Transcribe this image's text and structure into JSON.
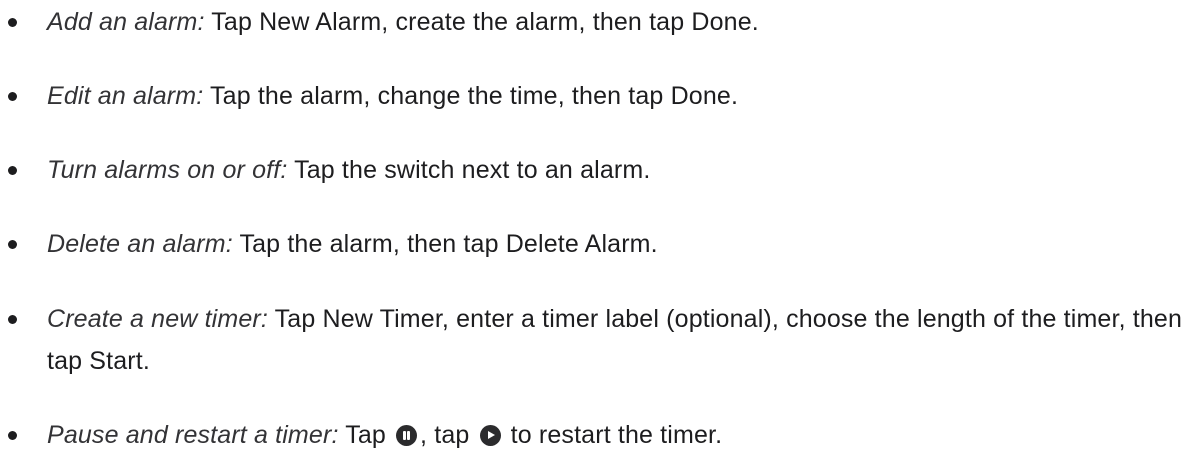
{
  "items": [
    {
      "term": "Add an alarm:",
      "text": " Tap New Alarm, create the alarm, then tap Done."
    },
    {
      "term": "Edit an alarm:",
      "text": " Tap the alarm, change the time, then tap Done."
    },
    {
      "term": "Turn alarms on or off:",
      "text": " Tap the switch next to an alarm."
    },
    {
      "term": "Delete an alarm:",
      "text": " Tap the alarm, then tap Delete Alarm."
    },
    {
      "term": "Create a new timer:",
      "text": " Tap New Timer, enter a timer label (optional), choose the length of the timer, then tap Start."
    },
    {
      "term": "Pause and restart a timer:",
      "text_before_pause": " Tap ",
      "text_between": ", tap ",
      "text_after_play": " to restart the timer."
    }
  ],
  "icons": {
    "pause": "pause-circle-icon",
    "play": "play-circle-icon"
  }
}
